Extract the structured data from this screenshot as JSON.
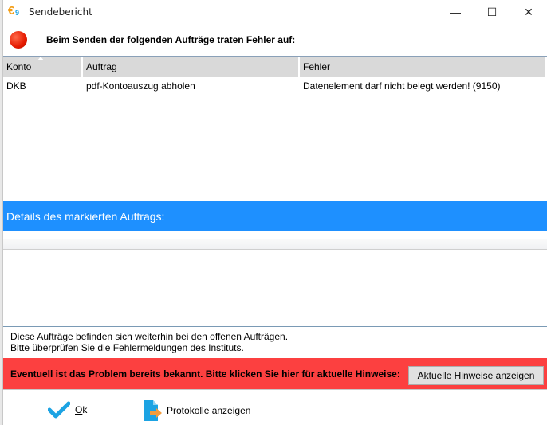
{
  "window": {
    "title": "Sendebericht",
    "minimize": "—",
    "maximize": "☐",
    "close": "✕"
  },
  "header": {
    "message": "Beim Senden der folgenden Aufträge traten Fehler auf:",
    "icon": "error-red-dot"
  },
  "table": {
    "columns": [
      "Konto",
      "Auftrag",
      "Fehler"
    ],
    "sorted_column": "Konto",
    "rows": [
      {
        "konto": "DKB",
        "auftrag": "pdf-Kontoauszug abholen",
        "fehler": "Datenelement darf nicht belegt werden! (9150)"
      }
    ]
  },
  "details": {
    "title": "Details des markierten Auftrags:"
  },
  "info": {
    "line1": "Diese Aufträge befinden sich weiterhin bei den offenen Aufträgen.",
    "line2": "Bitte überprüfen Sie die Fehlermeldungen des Instituts."
  },
  "hint": {
    "text": "Eventuell ist das Problem bereits bekannt. Bitte klicken Sie hier für aktuelle Hinweise:",
    "button": "Aktuelle Hinweise anzeigen",
    "color": "#fc4040"
  },
  "footer": {
    "ok_first": "O",
    "ok_rest": "k",
    "protokolle_first": "P",
    "protokolle_rest": "rotokolle anzeigen"
  },
  "colors": {
    "accent": "#1e90ff"
  }
}
